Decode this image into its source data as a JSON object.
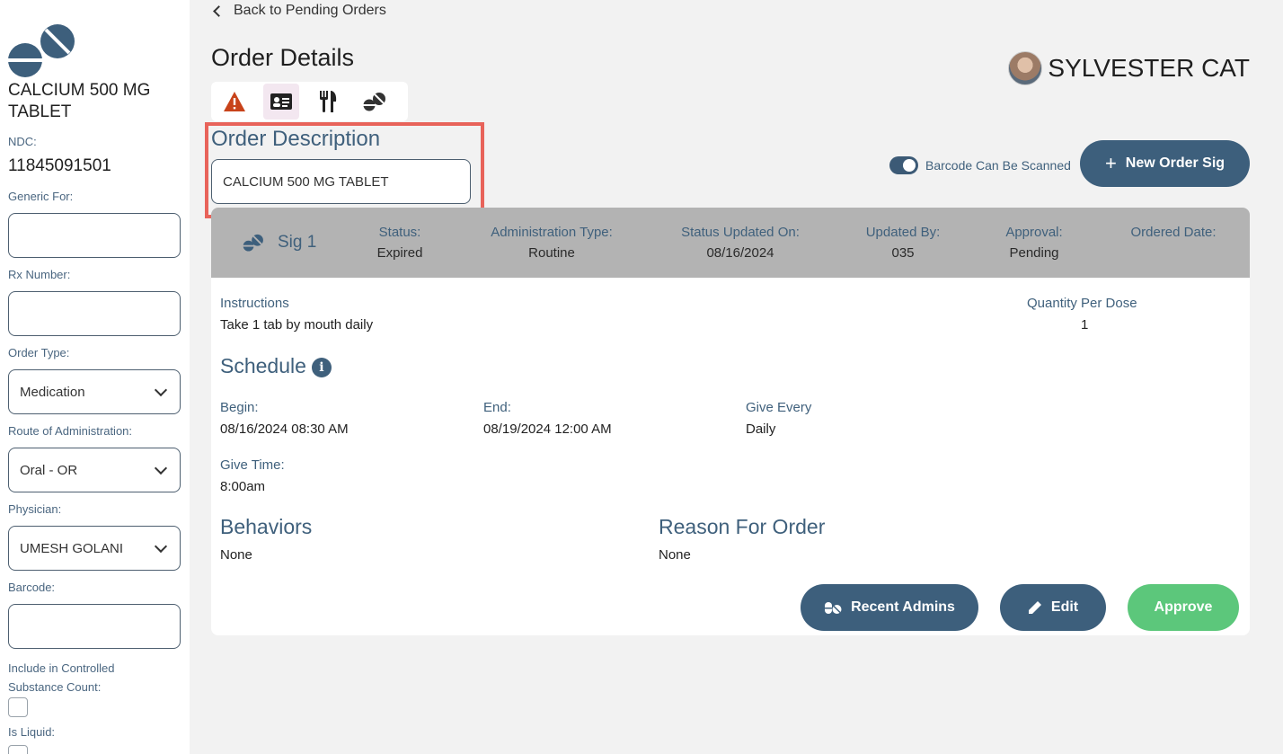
{
  "sidebar": {
    "med_name": "CALCIUM 500 MG TABLET",
    "ndc_label": "NDC:",
    "ndc_value": "11845091501",
    "generic_for_label": "Generic For:",
    "generic_for_value": "",
    "rx_number_label": "Rx Number:",
    "rx_number_value": "",
    "order_type_label": "Order Type:",
    "order_type_value": "Medication",
    "route_label": "Route of Administration:",
    "route_value": "Oral - OR",
    "physician_label": "Physician:",
    "physician_value": "UMESH GOLANI",
    "barcode_label": "Barcode:",
    "barcode_value": "",
    "controlled_label": "Include in Controlled Substance Count:",
    "liquid_label": "Is Liquid:"
  },
  "header": {
    "back_label": "Back to Pending Orders",
    "title": "Order Details",
    "patient_name": "SYLVESTER CAT",
    "tabs": [
      "warning-icon",
      "id-card-icon",
      "utensils-icon",
      "pills-icon"
    ]
  },
  "order_description": {
    "title": "Order Description",
    "value": "CALCIUM 500 MG TABLET"
  },
  "barcode_toggle": {
    "label": "Barcode Can Be Scanned",
    "on": true
  },
  "new_sig_button": "New Order Sig",
  "sig": {
    "title": "Sig 1",
    "columns": [
      {
        "label": "Status:",
        "value": "Expired"
      },
      {
        "label": "Administration Type:",
        "value": "Routine"
      },
      {
        "label": "Status Updated On:",
        "value": "08/16/2024"
      },
      {
        "label": "Updated By:",
        "value": "035"
      },
      {
        "label": "Approval:",
        "value": "Pending"
      },
      {
        "label": "Ordered Date:",
        "value": ""
      }
    ],
    "instructions_label": "Instructions",
    "instructions_value": "Take 1 tab by mouth daily",
    "qty_label": "Quantity Per Dose",
    "qty_value": "1",
    "schedule_title": "Schedule",
    "begin_label": "Begin:",
    "begin_value": "08/16/2024 08:30 AM",
    "end_label": "End:",
    "end_value": "08/19/2024 12:00 AM",
    "give_every_label": "Give Every",
    "give_every_value": "Daily",
    "give_time_label": "Give Time:",
    "give_time_value": "8:00am",
    "behaviors_title": "Behaviors",
    "behaviors_value": "None",
    "reason_title": "Reason For Order",
    "reason_value": "None"
  },
  "actions": {
    "recent_admins": "Recent Admins",
    "edit": "Edit",
    "approve": "Approve"
  },
  "colors": {
    "primary": "#3d5f7c",
    "approve": "#5cc77b",
    "highlight": "#e8635a",
    "warning": "#c8431a"
  }
}
